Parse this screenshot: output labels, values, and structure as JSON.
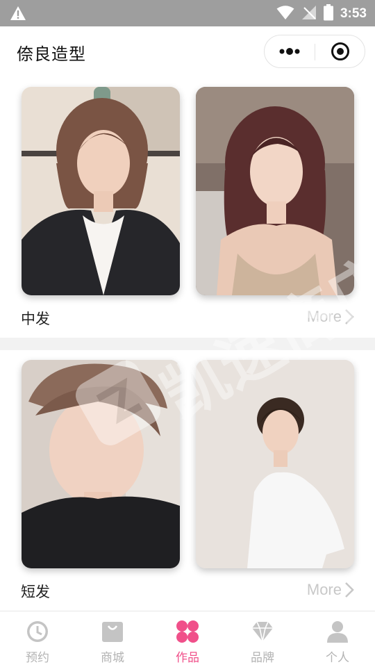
{
  "status_bar": {
    "time": "3:53"
  },
  "header": {
    "title": "倷良造型"
  },
  "sections": [
    {
      "label": "中发",
      "more": "More"
    },
    {
      "label": "短发",
      "more": "More"
    }
  ],
  "tabs": [
    {
      "label": "预约",
      "icon": "clock-icon"
    },
    {
      "label": "商城",
      "icon": "shopping-bag-icon"
    },
    {
      "label": "作品",
      "icon": "flower-icon"
    },
    {
      "label": "品牌",
      "icon": "diamond-icon"
    },
    {
      "label": "个人",
      "icon": "person-icon"
    }
  ],
  "active_tab": "作品",
  "colors": {
    "accent": "#f0508a",
    "tab_inactive": "#b3b3b3",
    "status_bar": "#9e9e9e",
    "more_link": "#c8c8c8"
  },
  "watermark": {
    "text": "凯速商店"
  }
}
